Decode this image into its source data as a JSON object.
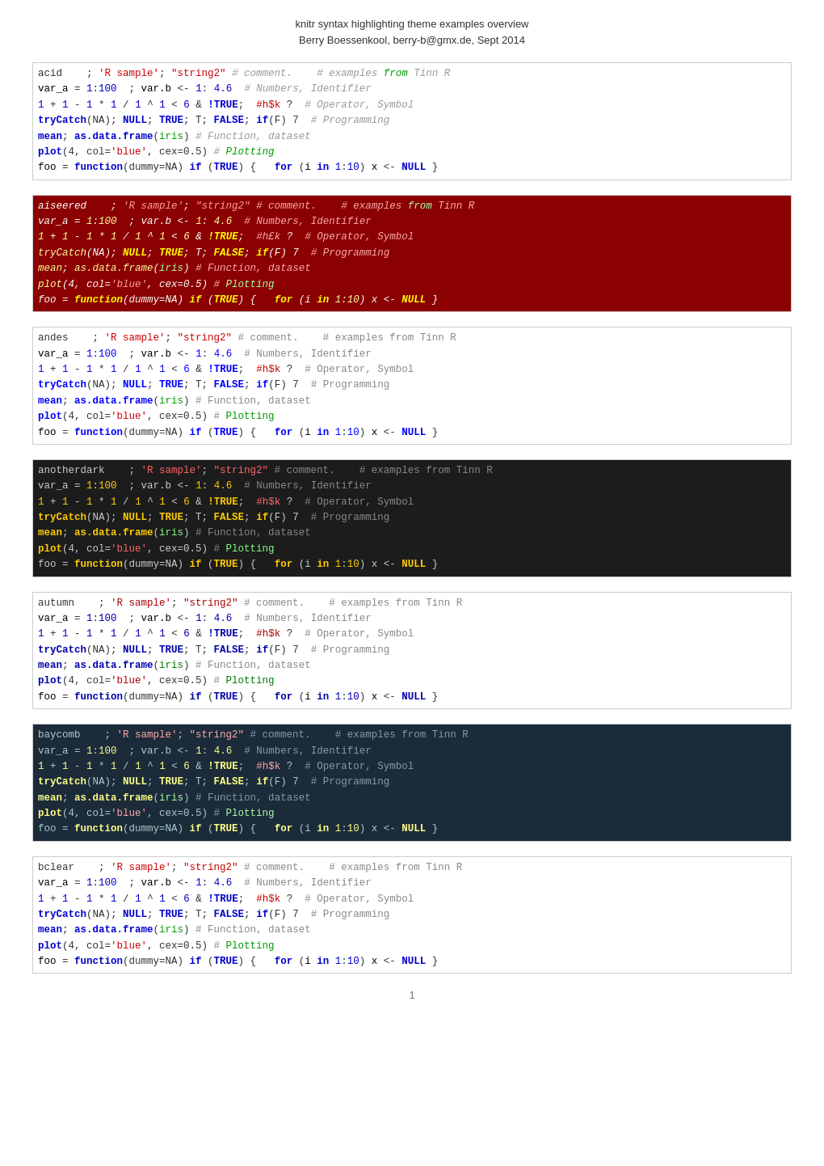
{
  "header": {
    "line1": "knitr syntax highlighting theme examples overview",
    "line2": "Berry Boessenkool, berry-b@gmx.de, Sept 2014"
  },
  "page_number": "1",
  "themes": [
    {
      "name": "acid",
      "theme_class": "acid",
      "lines": [
        {
          "id": "line1",
          "label": "acid_line1"
        },
        {
          "id": "line2",
          "label": "acid_line2"
        },
        {
          "id": "line3",
          "label": "acid_line3"
        },
        {
          "id": "line4",
          "label": "acid_line4"
        },
        {
          "id": "line5",
          "label": "acid_line5"
        },
        {
          "id": "line6",
          "label": "acid_line6"
        },
        {
          "id": "line7",
          "label": "acid_line7"
        }
      ]
    },
    {
      "name": "aiseered",
      "theme_class": "aiseered"
    },
    {
      "name": "andes",
      "theme_class": "andes"
    },
    {
      "name": "anotherdark",
      "theme_class": "anotherdark"
    },
    {
      "name": "autumn",
      "theme_class": "autumn"
    },
    {
      "name": "baycomb",
      "theme_class": "baycomb"
    },
    {
      "name": "bclear",
      "theme_class": "bclear"
    }
  ]
}
